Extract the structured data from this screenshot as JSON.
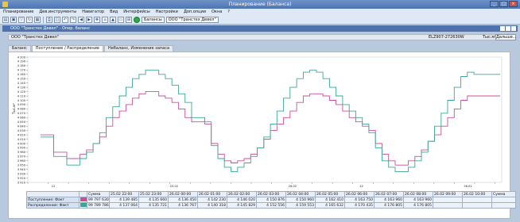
{
  "window": {
    "title": "Планирование (Баланса)"
  },
  "menu": [
    "Планирование",
    "Дев.инструменты",
    "Навигатор",
    "Вид",
    "Интерфейсы",
    "Настройки",
    "Доп.опции",
    "Окна",
    "?"
  ],
  "toolbar": {
    "field1": "Балансы",
    "field2": "ООО \"Транстех Девел\""
  },
  "subwindow": {
    "title": "ООО \"Транстех Девел\" - Опер. баланс"
  },
  "filter": {
    "company": "ООО \"Транстех Девел\"",
    "code": "ELZ907-272630W",
    "unit": "Тыс.м³",
    "button": "Дальше..."
  },
  "tabs": [
    "Баланс",
    "Поступление / Распределение",
    "Небаланс, Изменение запаса"
  ],
  "chart": {
    "y_axis_title": "Тыс.м³",
    "y_ticks": [
      "4 200",
      "4 190",
      "4 180",
      "4 170",
      "4 160",
      "4 150",
      "4 140",
      "4 130",
      "4 120",
      "4 110",
      "4 100",
      "4 090",
      "4 080",
      "4 070",
      "4 060",
      "4 050",
      "4 040",
      "4 030",
      "4 020",
      "4 010",
      "4 000",
      "3 990",
      "3 980",
      "3 970",
      "3 960",
      "3 950",
      "3 940",
      "3 930",
      "3 920",
      "3 910"
    ],
    "x_date_labels": [
      "12",
      "25.02",
      "26.02",
      "12",
      "26.02"
    ]
  },
  "chart_data": {
    "type": "line",
    "ylim": [
      3910,
      4200
    ],
    "series": [
      {
        "name": "Поступление: Факт",
        "color": "#c94f9c",
        "values": [
          4020,
          4020,
          3980,
          3980,
          3965,
          3965,
          3975,
          3985,
          4000,
          4015,
          4040,
          4060,
          4075,
          4090,
          4105,
          4115,
          4120,
          4120,
          4110,
          4105,
          4095,
          4080,
          4060,
          4050,
          4050,
          4045,
          4000,
          3975,
          3960,
          3955,
          3960,
          3965,
          3975,
          3990,
          4010,
          4030,
          4045,
          4060,
          4075,
          4095,
          4110,
          4115,
          4115,
          4110,
          4100,
          4090,
          4075,
          4060,
          4050,
          4040,
          4030,
          4000,
          3975,
          3960,
          3950,
          3950,
          3960,
          3970,
          3985,
          4005,
          4020,
          4040,
          4060,
          4080,
          4100,
          4110,
          4110,
          4110,
          4110,
          4110
        ]
      },
      {
        "name": "Распределение: Факт",
        "color": "#3aa699",
        "values": [
          4015,
          4015,
          3970,
          3970,
          3950,
          3950,
          3965,
          3980,
          4000,
          4025,
          4060,
          4085,
          4110,
          4130,
          4150,
          4160,
          4170,
          4170,
          4160,
          4150,
          4135,
          4115,
          4095,
          4060,
          4060,
          4050,
          3995,
          3965,
          3945,
          3935,
          3945,
          3955,
          3970,
          3990,
          4015,
          4045,
          4075,
          4105,
          4130,
          4150,
          4165,
          4170,
          4165,
          4150,
          4130,
          4110,
          4090,
          4075,
          4060,
          4045,
          4025,
          3990,
          3960,
          3945,
          3935,
          3935,
          3945,
          3960,
          3980,
          4005,
          4040,
          4070,
          4100,
          4130,
          4155,
          4165,
          4160,
          4160,
          4160,
          4160
        ]
      }
    ]
  },
  "table": {
    "headers": [
      "",
      "Сумма",
      "25.02 22:00",
      "25.02 23:00",
      "26.02 00:00",
      "26.02 01:00",
      "26.02 02:00",
      "26.02 03:00",
      "26.02 04:00",
      "26.02 05:00",
      "26.02 06:00",
      "26.02 07:00",
      "26.02 08:00",
      "26.02 09:00",
      "26.02 10:00",
      "26.02 11:00",
      "Сумма"
    ],
    "rows": [
      {
        "label": "Поступление: Факт",
        "values": [
          "99 797 630",
          "4 139 485",
          "4 135 660",
          "4 136 450",
          "4 142 230",
          "4 146 020",
          "4 150 876",
          "4 150 960",
          "4 162 410",
          "4 163 750",
          "4 163 960",
          "4 163 960",
          ""
        ]
      },
      {
        "label": "Распределение: Факт",
        "values": [
          "99 789 786",
          "4 137 064",
          "4 135 721",
          "4 136 767",
          "4 140 318",
          "4 145 829",
          "4 152 556",
          "4 159 553",
          "4 165 632",
          "4 170 435",
          "4 176 805",
          "4 176 805",
          ""
        ]
      }
    ]
  },
  "colors": {
    "series1": "#c94f9c",
    "series2": "#3aa699",
    "accent": "#4e72ad"
  }
}
